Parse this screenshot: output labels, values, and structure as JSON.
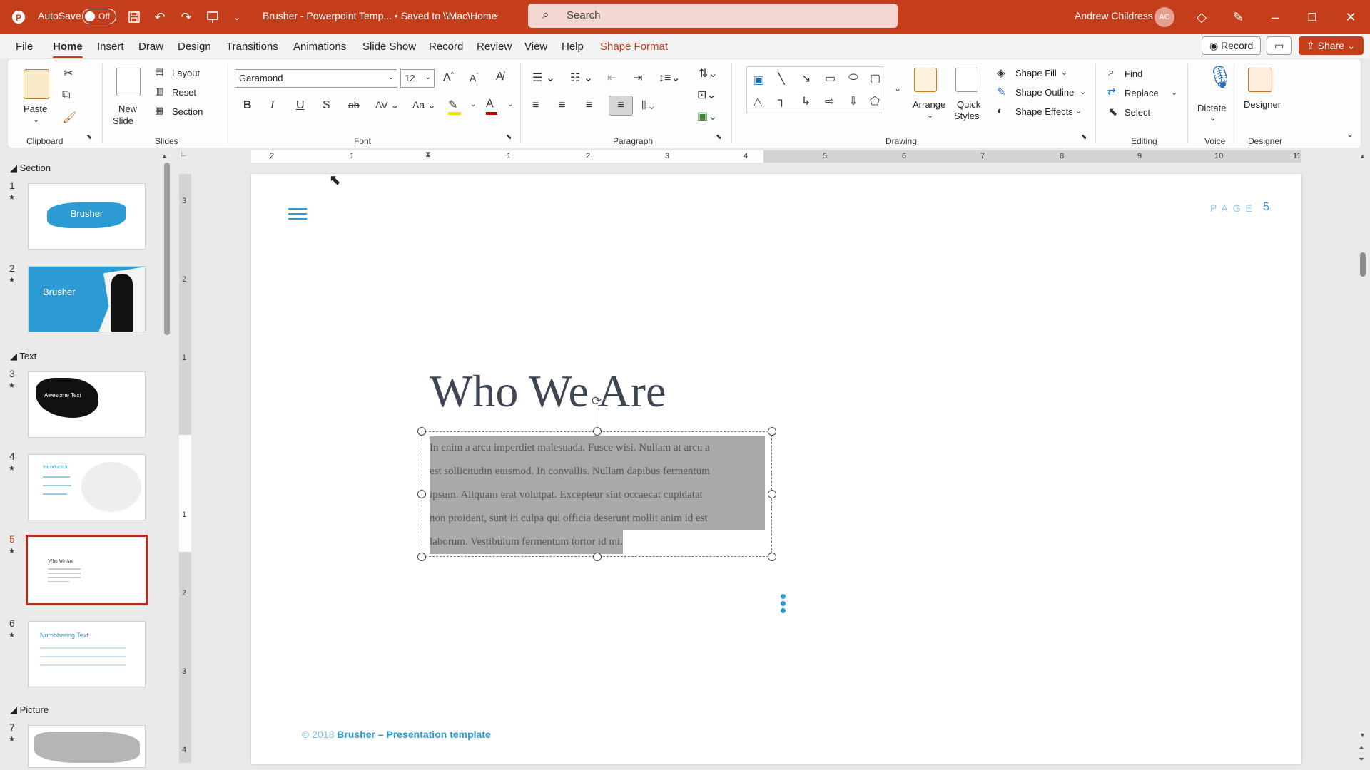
{
  "titlebar": {
    "autosave_label": "AutoSave",
    "autosave_state": "Off",
    "doc_title": "Brusher - Powerpoint Temp... • Saved to \\\\Mac\\Home",
    "search_placeholder": "Search",
    "user_name": "Andrew Childress",
    "user_initials": "AC"
  },
  "menu": {
    "tabs": [
      "File",
      "Home",
      "Insert",
      "Draw",
      "Design",
      "Transitions",
      "Animations",
      "Slide Show",
      "Record",
      "Review",
      "View",
      "Help",
      "Shape Format"
    ],
    "active_tab": "Home",
    "record_label": "Record",
    "share_label": "Share"
  },
  "ribbon": {
    "clipboard": {
      "paste": "Paste",
      "label": "Clipboard"
    },
    "slides": {
      "new_slide_1": "New",
      "new_slide_2": "Slide",
      "layout": "Layout",
      "reset": "Reset",
      "section": "Section",
      "label": "Slides"
    },
    "font": {
      "family": "Garamond",
      "size": "12",
      "label": "Font"
    },
    "paragraph": {
      "label": "Paragraph"
    },
    "drawing": {
      "arrange": "Arrange",
      "quick_styles_1": "Quick",
      "quick_styles_2": "Styles",
      "shape_fill": "Shape Fill",
      "shape_outline": "Shape Outline",
      "shape_effects": "Shape Effects",
      "label": "Drawing"
    },
    "editing": {
      "find": "Find",
      "replace": "Replace",
      "select": "Select",
      "label": "Editing"
    },
    "voice": {
      "dictate": "Dictate",
      "label": "Voice"
    },
    "designer": {
      "designer": "Designer",
      "label": "Designer"
    }
  },
  "thumbnails": {
    "sections": [
      "Section",
      "Text",
      "Picture"
    ],
    "slides": [
      {
        "num": "1",
        "caption": "Brusher"
      },
      {
        "num": "2",
        "caption": "Brusher"
      },
      {
        "num": "3",
        "caption": "Awesome Text"
      },
      {
        "num": "4",
        "caption": "Introduction"
      },
      {
        "num": "5",
        "caption": "Who We Are"
      },
      {
        "num": "6",
        "caption": "Numbbering Text"
      },
      {
        "num": "7",
        "caption": ""
      }
    ],
    "selected": "5"
  },
  "ruler": {
    "top_labels": [
      "2",
      "1",
      "1",
      "2",
      "3",
      "4",
      "5",
      "6",
      "7",
      "8",
      "9",
      "10",
      "11"
    ],
    "left_labels": [
      "3",
      "2",
      "1",
      "1",
      "2",
      "3",
      "4"
    ]
  },
  "slide": {
    "page_label": "PAGE",
    "page_number": "5",
    "title": "Who We Are",
    "body_lines": [
      "In enim a arcu imperdiet malesuada. Fusce wisi. Nullam at arcu a",
      "est sollicitudin euismod. In convallis. Nullam dapibus fermentum",
      "ipsum. Aliquam erat volutpat. Excepteur sint occaecat cupidatat",
      "non proident, sunt in culpa qui officia deserunt mollit anim id est",
      "laborum. Vestibulum fermentum tortor id mi."
    ],
    "footer_prefix": "© 2018",
    "footer_brand": "Brusher – Presentation template"
  },
  "colors": {
    "accent": "#c43e1c",
    "brand_blue": "#2d9bd3",
    "selection_gray": "#a9a9a9"
  }
}
